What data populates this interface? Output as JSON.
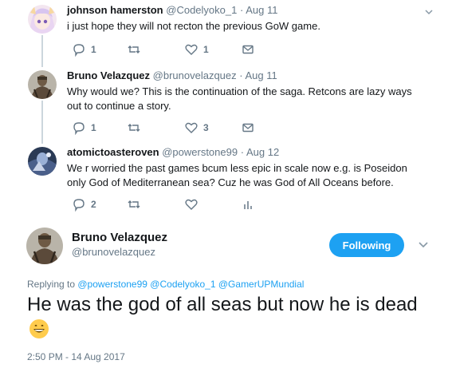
{
  "tweets": [
    {
      "name": "johnson hamerston",
      "handle": "@Codelyoko_1",
      "sep": "·",
      "time": "Aug 11",
      "text": "i just hope they will not recton the previous GoW game.",
      "replies": "1",
      "retweets": "",
      "likes": "1"
    },
    {
      "name": "Bruno Velazquez",
      "handle": "@brunovelazquez",
      "sep": "·",
      "time": "Aug 11",
      "text": "Why would we?  This is the continuation of the saga.  Retcons are lazy ways out to continue a story.",
      "replies": "1",
      "retweets": "",
      "likes": "3"
    },
    {
      "name": "atomictoasteroven",
      "handle": "@powerstone99",
      "sep": "·",
      "time": "Aug 12",
      "text": "We r worried the past games bcum less epic in scale now e.g. is Poseidon only God of Mediterranean sea? Cuz he was God of All Oceans before.",
      "replies": "2",
      "retweets": "",
      "likes": ""
    }
  ],
  "focus": {
    "name": "Bruno Velazquez",
    "handle": "@brunovelazquez",
    "follow_label": "Following",
    "replying_prefix": "Replying to ",
    "mentions": [
      "@powerstone99",
      "@Codelyoko_1",
      "@GamerUPMundial"
    ],
    "text": "He was the god of all seas but now he is dead",
    "timestamp": "2:50 PM - 14 Aug 2017"
  },
  "colors": {
    "accent": "#1da1f2",
    "muted": "#657786",
    "thread_line": "#ccd6dd"
  }
}
